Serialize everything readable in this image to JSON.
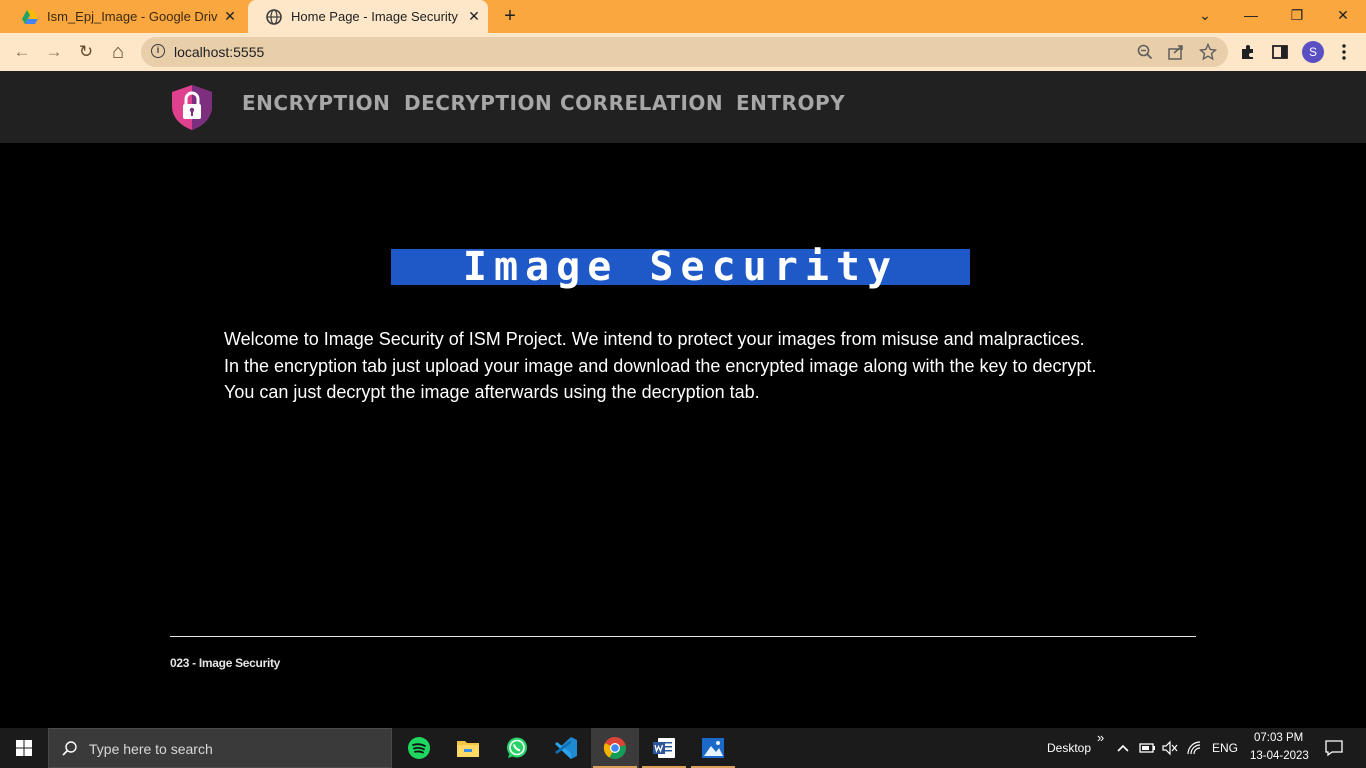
{
  "browser": {
    "tabs": [
      {
        "title": "Ism_Epj_Image - Google Drive",
        "close": "✕"
      },
      {
        "title": "Home Page - Image Security",
        "close": "✕"
      }
    ],
    "new_tab": "+",
    "window_controls": {
      "chevron": "⌄",
      "minimize": "—",
      "restore": "❐",
      "close": "✕"
    },
    "url": "localhost:5555",
    "nav": {
      "back": "←",
      "forward": "→",
      "reload": "↻",
      "home": "⌂"
    },
    "icons": {
      "zoom": "search-icon",
      "share": "share-icon",
      "bookmark": "star-icon",
      "extensions": "puzzle-icon",
      "sidepanel": "sidepanel-icon",
      "menu": "kebab-menu-icon"
    },
    "profile_initial": "S"
  },
  "site": {
    "nav_links": [
      "ENCRYPTION",
      "DECRYPTION",
      "CORRELATION",
      "ENTROPY"
    ],
    "hero_title": "Image Security",
    "intro_lines": [
      "Welcome to Image Security of ISM Project. We intend to protect your images from misuse and malpractices.",
      "In the encryption tab just upload your image and download the encrypted image along with the key to decrypt.",
      "You can just decrypt the image afterwards using the decryption tab."
    ],
    "footer": "023 - Image Security",
    "colors": {
      "hero_bg": "#1e59c7",
      "nav_bg": "#212121",
      "nav_text": "#a7a7a7",
      "logo_pink": "#e0418f",
      "logo_purple": "#7b2f7e"
    }
  },
  "taskbar": {
    "search_placeholder": "Type here to search",
    "apps": [
      "spotify-icon",
      "file-explorer-icon",
      "whatsapp-icon",
      "vscode-icon",
      "chrome-icon",
      "word-icon",
      "photos-icon"
    ],
    "desktop_label": "Desktop",
    "overflow": "»",
    "language": "ENG",
    "time": "07:03 PM",
    "date": "13-04-2023"
  }
}
